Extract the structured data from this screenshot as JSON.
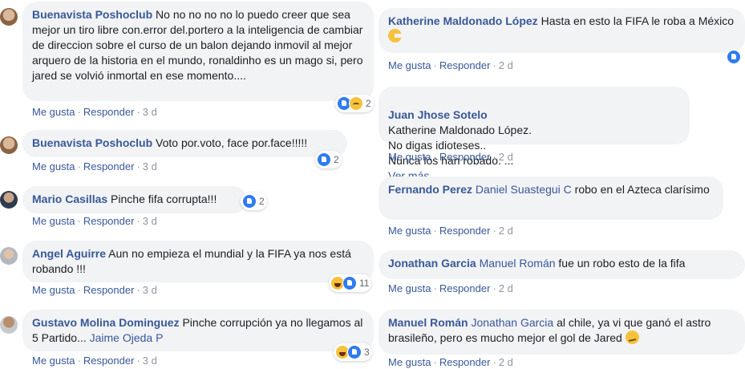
{
  "actions": {
    "like": "Me gusta",
    "reply": "Responder"
  },
  "left": [
    {
      "author": "Buenavista Poshoclub",
      "text": "No no no no no lo puedo creer que sea mejor un tiro libre con.error del.portero a la inteligencia de cambiar de direccion sobre el curso de un balon dejando inmovil al mejor arquero de la historia en el mundo, ronaldinho es un mago si, pero jared se volvió inmortal en ese momento....",
      "time": "3 d",
      "reaction_count": "2",
      "reaction_icons": [
        "like-icon",
        "sad-icon"
      ]
    },
    {
      "author": "Buenavista Poshoclub",
      "text": "Voto por.voto, face por.face!!!!!",
      "time": "3 d",
      "reaction_count": "2",
      "reaction_icons": [
        "like-icon"
      ]
    },
    {
      "author": "Mario Casillas",
      "text": "Pinche fifa corrupta!!!",
      "time": "3 d",
      "reaction_count": "2",
      "reaction_icons": [
        "like-icon"
      ]
    },
    {
      "author": "Angel Aguirre",
      "text": "Aun no empieza el mundial y la FIFA ya nos está robando !!!",
      "time": "3 d",
      "reaction_count": "11",
      "reaction_icons": [
        "haha-icon",
        "like-icon"
      ]
    },
    {
      "author": "Gustavo Molina Dominguez",
      "text": "Pinche corrupción ya no llegamos al 5 Partido...",
      "mention": "Jaime Ojeda P",
      "time": "3 d",
      "reaction_count": "3",
      "reaction_icons": [
        "haha-icon",
        "like-icon"
      ]
    }
  ],
  "right": [
    {
      "author": "Katherine Maldonado López",
      "text": "Hasta en esto la FIFA le roba a México",
      "emoji": "pacman-icon",
      "time": "2 d"
    },
    {
      "author": "Juan Jhose Sotelo",
      "text": "Katherine Maldonado López.\nNo digas idioteses..\nNunca los han robado. ...",
      "see_more": "Ver más",
      "time": "2 d"
    },
    {
      "author": "Fernando Perez",
      "mention": "Daniel Suastegui C",
      "text": "robo en el Azteca clarísimo",
      "time": "2 d"
    },
    {
      "author": "Jonathan Garcia",
      "mention": "Manuel Román",
      "text": "fue un robo esto de la fifa",
      "time": "2 d"
    },
    {
      "author": "Manuel Román",
      "mention": "Jonathan Garcia",
      "text": "al chile, ya vi que ganó el astro brasileño, pero es mucho mejor el gol de Jared",
      "emoji": "confused-face-icon",
      "time": "2 d"
    }
  ]
}
